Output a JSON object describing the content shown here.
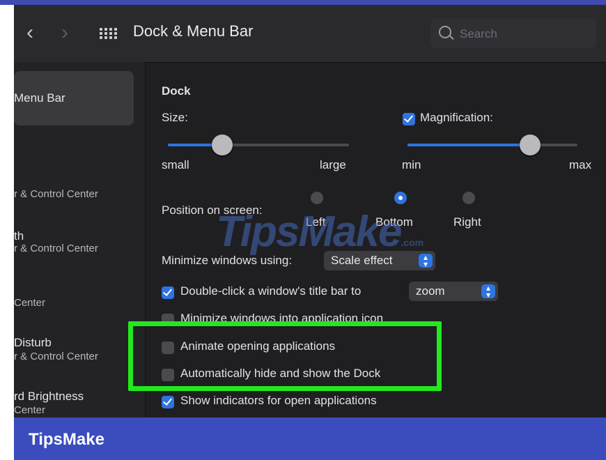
{
  "window": {
    "title": "Dock & Menu Bar",
    "search_placeholder": "Search",
    "back_icon": "chevron-left-icon",
    "forward_icon": "chevron-right-icon"
  },
  "sidebar": {
    "items": [
      {
        "label": "Menu Bar",
        "selected": true
      },
      {
        "label": "",
        "sub": "r & Control Center"
      },
      {
        "label": "th",
        "sub": "r & Control Center"
      },
      {
        "label": "",
        "sub": "Center"
      },
      {
        "label": "Disturb",
        "sub": "r & Control Center"
      },
      {
        "label": "rd Brightness",
        "sub": "Center"
      }
    ]
  },
  "dock": {
    "section_title": "Dock",
    "size_label": "Size:",
    "size_min": "small",
    "size_max": "large",
    "size_value": 0.3,
    "magnification_label": "Magnification:",
    "magnification_checked": true,
    "mag_min": "min",
    "mag_max": "max",
    "mag_value": 0.72,
    "position_label": "Position on screen:",
    "positions": [
      "Left",
      "Bottom",
      "Right"
    ],
    "position_selected": "Bottom",
    "minimize_label": "Minimize windows using:",
    "minimize_value": "Scale effect",
    "doubleclick_label": "Double-click a window's title bar to",
    "doubleclick_checked": true,
    "doubleclick_value": "zoom",
    "minimize_into_icon_label": "Minimize windows into application icon",
    "minimize_into_icon_checked": false,
    "animate_label": "Animate opening applications",
    "animate_checked": false,
    "autohide_label": "Automatically hide and show the Dock",
    "autohide_checked": false,
    "indicators_label": "Show indicators for open applications",
    "indicators_checked": true
  },
  "watermark": {
    "text": "TipsMake",
    "suffix": ".com"
  },
  "footer": {
    "brand": "TipsMake"
  },
  "colors": {
    "accent": "#2f74e0",
    "highlight": "#22e81f",
    "footer": "#3b4cbd"
  }
}
